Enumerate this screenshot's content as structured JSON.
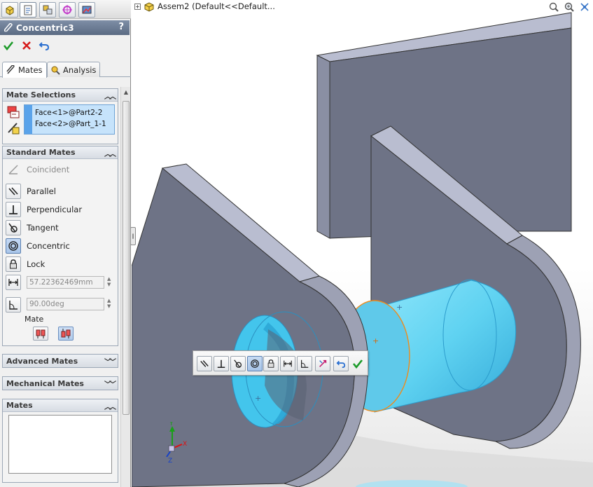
{
  "manager_tabs": [
    {
      "icon": "featuremanager-icon"
    },
    {
      "icon": "propertymanager-icon",
      "active": true
    },
    {
      "icon": "configurationmanager-icon"
    },
    {
      "icon": "dimxpert-icon"
    },
    {
      "icon": "display-manager-icon"
    }
  ],
  "property_manager": {
    "title": "Concentric3",
    "help_label": "?",
    "ok_icon": "ok-check-icon",
    "cancel_icon": "cancel-x-icon",
    "undo_icon": "undo-icon",
    "tabs": [
      {
        "label": "Mates",
        "icon": "mates-icon",
        "active": true
      },
      {
        "label": "Analysis",
        "icon": "analysis-icon",
        "active": false
      }
    ]
  },
  "mate_selections": {
    "header": "Mate Selections",
    "items": [
      "Face<1>@Part2-2",
      "Face<2>@Part_1-1"
    ]
  },
  "standard_mates": {
    "header": "Standard Mates",
    "options": [
      {
        "label": "Coincident",
        "icon": "coincident-icon",
        "disabled": true
      },
      {
        "label": "Parallel",
        "icon": "parallel-icon"
      },
      {
        "label": "Perpendicular",
        "icon": "perpendicular-icon"
      },
      {
        "label": "Tangent",
        "icon": "tangent-icon"
      },
      {
        "label": "Concentric",
        "icon": "concentric-icon",
        "selected": true
      },
      {
        "label": "Lock",
        "icon": "lock-icon"
      }
    ],
    "distance_value": "57.22362469mm",
    "angle_value": "90.00deg",
    "alignment_label": "Mate"
  },
  "advanced_mates": {
    "header": "Advanced Mates"
  },
  "mechanical_mates": {
    "header": "Mechanical Mates"
  },
  "mates_list": {
    "header": "Mates",
    "items": []
  },
  "graphics": {
    "tree_label": "Assem2  (Default<<Default...",
    "tree_expander": "+",
    "background_top": "#ffffff",
    "plate_color": "#6f7486",
    "highlight_color": "#66d6f4",
    "edge_highlight_color": "#f08a1a"
  },
  "triad": {
    "x": "X",
    "y": "Y",
    "z": "Z"
  },
  "colors": {
    "title_bar": "#6a7a92",
    "selection_box": "#c6e3fb",
    "accent_blue": "#5aa3ea"
  }
}
